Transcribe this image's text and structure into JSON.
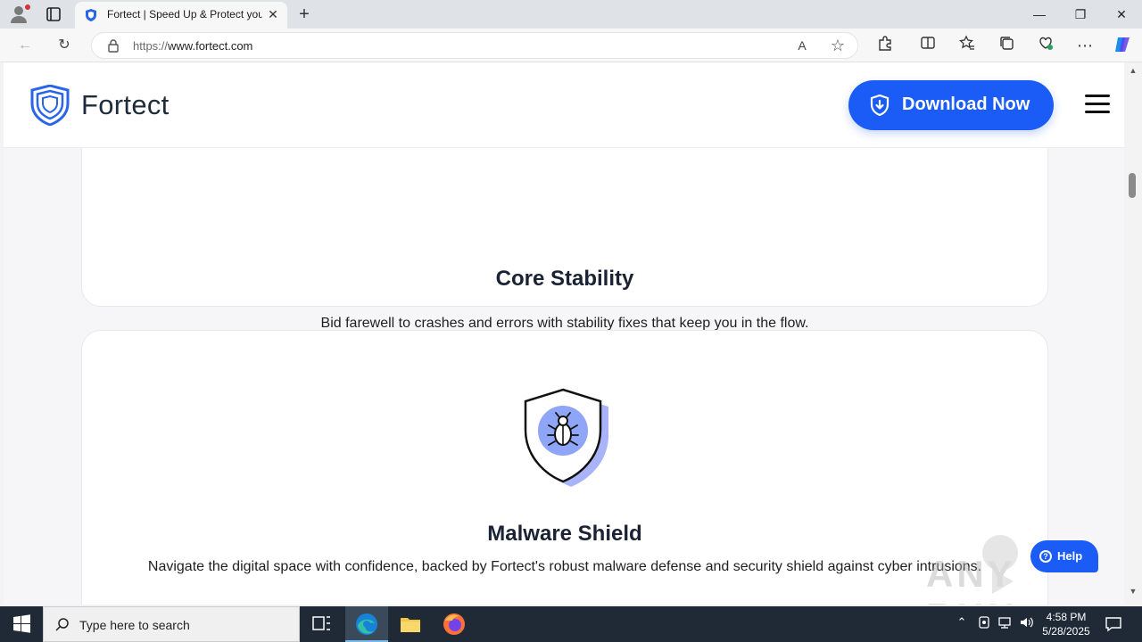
{
  "browser": {
    "tab_title": "Fortect | Speed Up & Protect your",
    "tab_close": "✕",
    "new_tab": "+",
    "url_scheme": "https://",
    "url_host": "www.fortect.com",
    "win_minimize": "—",
    "win_restore": "❐",
    "win_close": "✕",
    "back": "←",
    "refresh": "↻",
    "read_aloud": "A",
    "favorite": "☆",
    "more": "⋯"
  },
  "site": {
    "logo_text": "Fortect",
    "download_label": "Download Now",
    "brand_color": "#1a5cf5"
  },
  "cards": [
    {
      "title": "Core Stability",
      "description": "Bid farewell to crashes and errors with stability fixes that keep you in the flow."
    },
    {
      "title": "Malware Shield",
      "description": "Navigate the digital space with confidence, backed by Fortect's robust malware defense and security shield against cyber intrusions."
    }
  ],
  "help": {
    "label": "Help",
    "glyph": "?"
  },
  "watermark": {
    "text": "ANY RUN"
  },
  "taskbar": {
    "search_placeholder": "Type here to search",
    "time": "4:58 PM",
    "date": "5/28/2025"
  },
  "icons": [
    "profile-icon",
    "tabs-icon",
    "fortect-tab-icon",
    "lock-icon",
    "extensions-icon",
    "split-screen-icon",
    "favorites-icon",
    "collections-icon",
    "copilot-icon",
    "shield-download-icon",
    "menu-icon",
    "bug-shield-icon",
    "windows-start-icon",
    "search-icon",
    "task-view-icon",
    "edge-icon",
    "file-explorer-icon",
    "firefox-icon"
  ]
}
